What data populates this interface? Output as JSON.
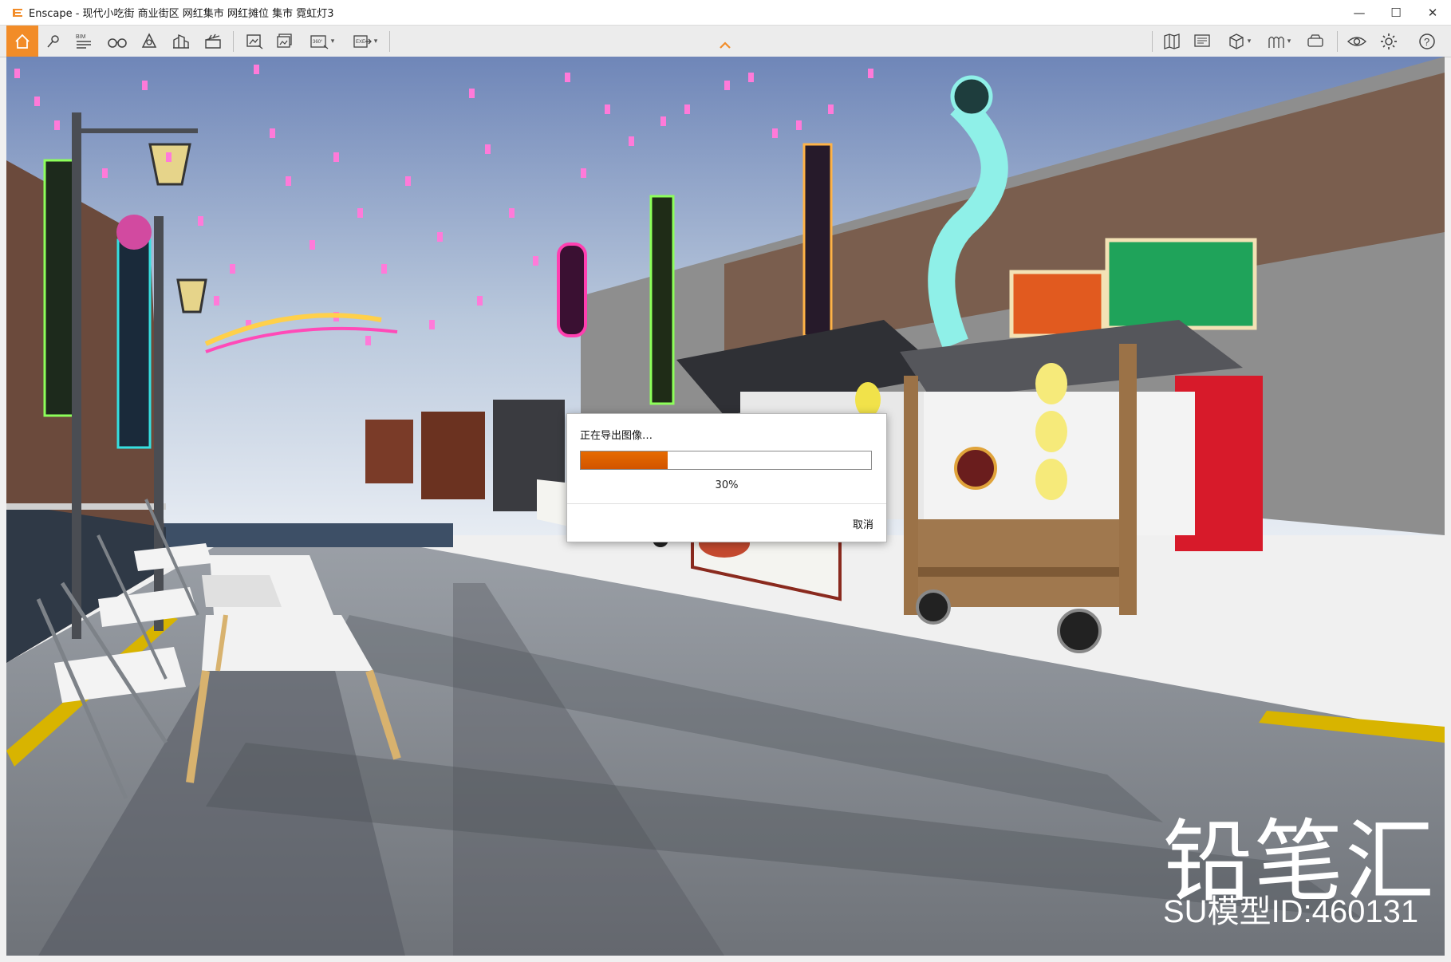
{
  "window": {
    "title": "Enscape - 现代小吃街 商业街区 网红集市 网红摊位 集市 霓虹灯3",
    "controls": {
      "minimize": "—",
      "maximize": "☐",
      "close": "✕"
    }
  },
  "toolbar": {
    "home_icon": "home-icon",
    "bim_label": "BIM",
    "panorama_label": "360°",
    "exe_label": "EXE",
    "caret": "▾",
    "collapse": "^"
  },
  "dialog": {
    "title": "正在导出图像…",
    "progress_value": 0.3,
    "progress_text": "30%",
    "cancel_label": "取消"
  },
  "watermark": {
    "brand": "铅笔汇",
    "model_id": "SU模型ID:460131"
  },
  "colors": {
    "accent": "#f28c28",
    "progress": "#e06000",
    "sky_top": "#6f86b8",
    "sky_bottom": "#e7ecf3"
  }
}
